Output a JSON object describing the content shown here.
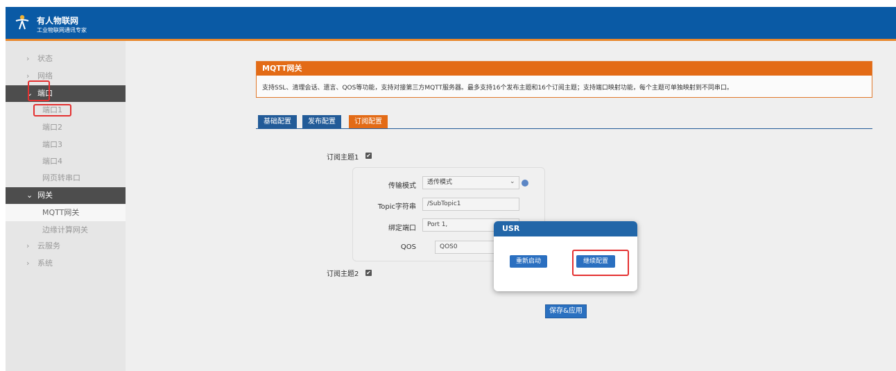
{
  "header": {
    "title": "有人物联网",
    "subtitle": "工业物联网通讯专家",
    "logo_icon": "person-logo-icon"
  },
  "sidebar": {
    "items": [
      {
        "label": "状态",
        "type": "collapsed"
      },
      {
        "label": "网络",
        "type": "collapsed"
      },
      {
        "label": "端口",
        "type": "group"
      },
      {
        "label": "端口1",
        "type": "sub"
      },
      {
        "label": "端口2",
        "type": "sub"
      },
      {
        "label": "端口3",
        "type": "sub"
      },
      {
        "label": "端口4",
        "type": "sub"
      },
      {
        "label": "网页转串口",
        "type": "sub"
      },
      {
        "label": "网关",
        "type": "group"
      },
      {
        "label": "MQTT网关",
        "type": "sub-active"
      },
      {
        "label": "边缘计算网关",
        "type": "sub"
      },
      {
        "label": "云服务",
        "type": "collapsed"
      },
      {
        "label": "系统",
        "type": "collapsed"
      }
    ]
  },
  "gateway": {
    "title": "MQTT网关",
    "description": "支持SSL、清理会话、遗言、QOS等功能，支持对接第三方MQTT服务器。最多支持16个发布主题和16个订阅主题；支持端口映射功能，每个主题可单独映射到不同串口。"
  },
  "tabs": [
    {
      "label": "基础配置",
      "active": false
    },
    {
      "label": "发布配置",
      "active": false
    },
    {
      "label": "订阅配置",
      "active": true
    }
  ],
  "subscription": {
    "topic1_label": "订阅主题1",
    "topic1_checked": "✔",
    "topic2_label": "订阅主题2",
    "topic2_checked": "✔",
    "fields": {
      "transfer_mode_label": "传输模式",
      "transfer_mode_value": "透传模式",
      "topic_string_label": "Topic字符串",
      "topic_string_value": "/SubTopic1",
      "bind_port_label": "绑定端口",
      "bind_port_value": "Port 1,",
      "qos_label": "QOS",
      "qos_value": "QOS0"
    },
    "save_label": "保存&应用"
  },
  "modal": {
    "title": "USR",
    "restart_label": "重新启动",
    "continue_label": "继续配置"
  },
  "colors": {
    "header_blue": "#0a5aa5",
    "accent_orange": "#e36b16",
    "tab_blue": "#225b98",
    "highlight_red": "#e43030"
  }
}
